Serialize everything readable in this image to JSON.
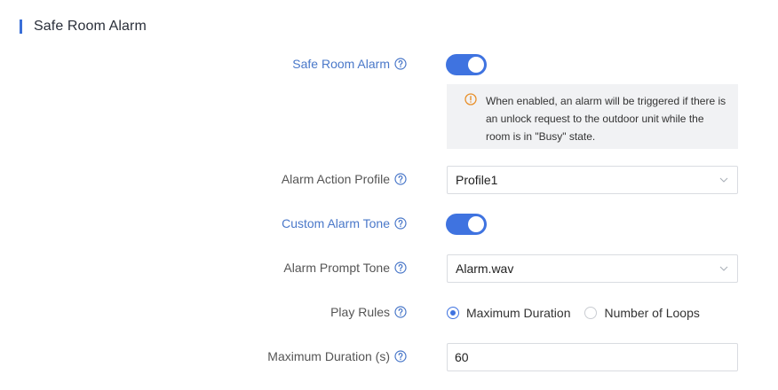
{
  "section": {
    "title": "Safe Room Alarm"
  },
  "fields": {
    "safe_room_alarm": {
      "label": "Safe Room Alarm",
      "enabled": true
    },
    "notice": {
      "text": "When enabled, an alarm will be triggered if there is an unlock request to the outdoor unit while the room is in \"Busy\" state."
    },
    "alarm_action_profile": {
      "label": "Alarm Action Profile",
      "value": "Profile1"
    },
    "custom_alarm_tone": {
      "label": "Custom Alarm Tone",
      "enabled": true
    },
    "alarm_prompt_tone": {
      "label": "Alarm Prompt Tone",
      "value": "Alarm.wav"
    },
    "play_rules": {
      "label": "Play Rules",
      "options": [
        {
          "label": "Maximum Duration",
          "selected": true
        },
        {
          "label": "Number of Loops",
          "selected": false
        }
      ]
    },
    "maximum_duration": {
      "label": "Maximum Duration (s)",
      "value": "60"
    }
  },
  "colors": {
    "accent": "#3f73e0",
    "label_blue": "#4a78c9",
    "warning": "#e8902a"
  },
  "icons": {
    "help": "question-circle-icon",
    "warning": "exclamation-circle-icon",
    "dropdown": "chevron-down-icon"
  }
}
